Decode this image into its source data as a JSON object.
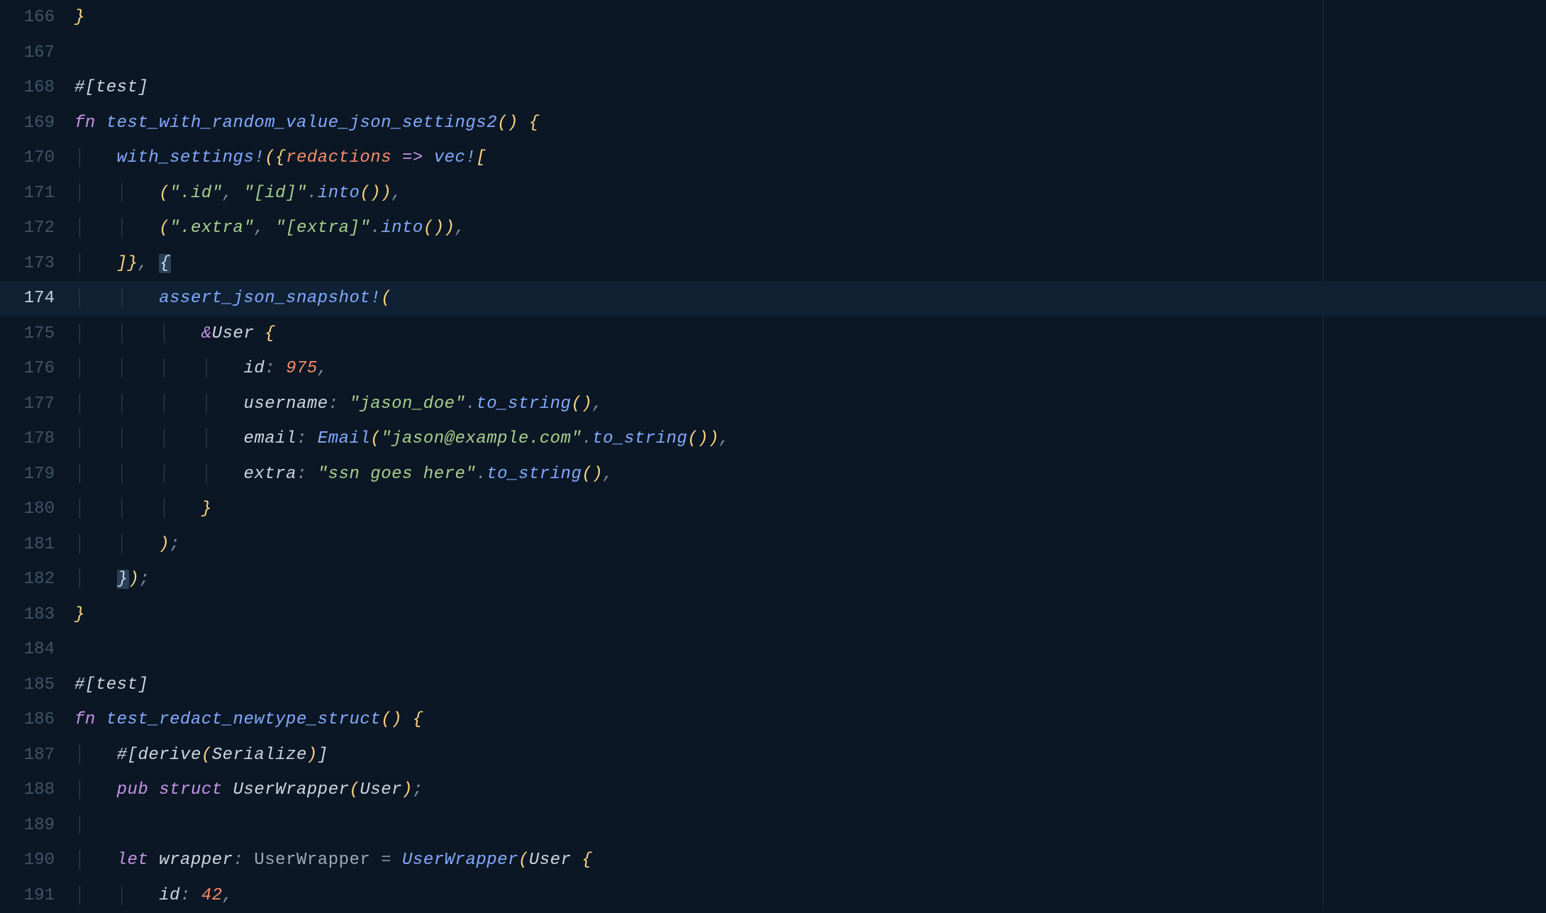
{
  "gutter": {
    "l166": "166",
    "l167": "167",
    "l168": "168",
    "l169": "169",
    "l170": "170",
    "l171": "171",
    "l172": "172",
    "l173": "173",
    "l174": "174",
    "l175": "175",
    "l176": "176",
    "l177": "177",
    "l178": "178",
    "l179": "179",
    "l180": "180",
    "l181": "181",
    "l182": "182",
    "l183": "183",
    "l184": "184",
    "l185": "185",
    "l186": "186",
    "l187": "187",
    "l188": "188",
    "l189": "189",
    "l190": "190",
    "l191": "191"
  },
  "code": {
    "l166": {
      "brace": "}"
    },
    "l168": {
      "hash": "#[",
      "attr": "test",
      "close": "]"
    },
    "l169": {
      "fn": "fn",
      "name": "test_with_random_value_json_settings2",
      "parens": "()",
      "brace": " {"
    },
    "l170": {
      "macro": "with_settings!",
      "op1": "(",
      "brace1": "{",
      "redactions": "redactions",
      "arrow": " => ",
      "vec": "vec!",
      "bracket": "["
    },
    "l171": {
      "open": "(",
      "s1": "\".id\"",
      "comma": ", ",
      "s2": "\"[id]\"",
      "dot": ".",
      "into": "into",
      "p": "()",
      "close": ")",
      "comma2": ","
    },
    "l172": {
      "open": "(",
      "s1": "\".extra\"",
      "comma": ", ",
      "s2": "\"[extra]\"",
      "dot": ".",
      "into": "into",
      "p": "()",
      "close": ")",
      "comma2": ","
    },
    "l173": {
      "close": "]}",
      "comma": ", ",
      "brace": "{"
    },
    "l174": {
      "macro": "assert_json_snapshot!",
      "open": "("
    },
    "l175": {
      "amp": "&",
      "ty": "User",
      "brace": " {"
    },
    "l176": {
      "field": "id",
      "colon": ": ",
      "val": "975",
      "comma": ","
    },
    "l177": {
      "field": "username",
      "colon": ": ",
      "val": "\"jason_doe\"",
      "dot": ".",
      "method": "to_string",
      "p": "()",
      "comma": ","
    },
    "l178": {
      "field": "email",
      "colon": ": ",
      "ty": "Email",
      "open": "(",
      "val": "\"jason@example.com\"",
      "dot": ".",
      "method": "to_string",
      "p": "()",
      "close": ")",
      "comma": ","
    },
    "l179": {
      "field": "extra",
      "colon": ": ",
      "val": "\"ssn goes here\"",
      "dot": ".",
      "method": "to_string",
      "p": "()",
      "comma": ","
    },
    "l180": {
      "brace": "}"
    },
    "l181": {
      "paren": ")",
      "semi": ";"
    },
    "l182": {
      "close": "})",
      "semi": ";"
    },
    "l183": {
      "brace": "}"
    },
    "l185": {
      "hash": "#[",
      "attr": "test",
      "close": "]"
    },
    "l186": {
      "fn": "fn",
      "name": "test_redact_newtype_struct",
      "parens": "()",
      "brace": " {"
    },
    "l187": {
      "hash": "#[",
      "derive": "derive",
      "open": "(",
      "ser": "Serialize",
      "close": ")",
      "bclose": "]"
    },
    "l188": {
      "pub": "pub",
      "struct": "struct",
      "name": " UserWrapper",
      "open": "(",
      "inner": "User",
      "close": ")",
      "semi": ";"
    },
    "l190": {
      "let": "let",
      "var": " wrapper",
      "colon": ": ",
      "ty": "UserWrapper",
      "eq": " = ",
      "ctor": "UserWrapper",
      "open": "(",
      "user": "User",
      "brace": " {"
    },
    "l191": {
      "field": "id",
      "colon": ": ",
      "val": "42",
      "comma": ","
    }
  },
  "guides": {
    "g1": "│",
    "g2": "│   │",
    "g3": "│   │   │",
    "g4": "│   │   │   │"
  }
}
